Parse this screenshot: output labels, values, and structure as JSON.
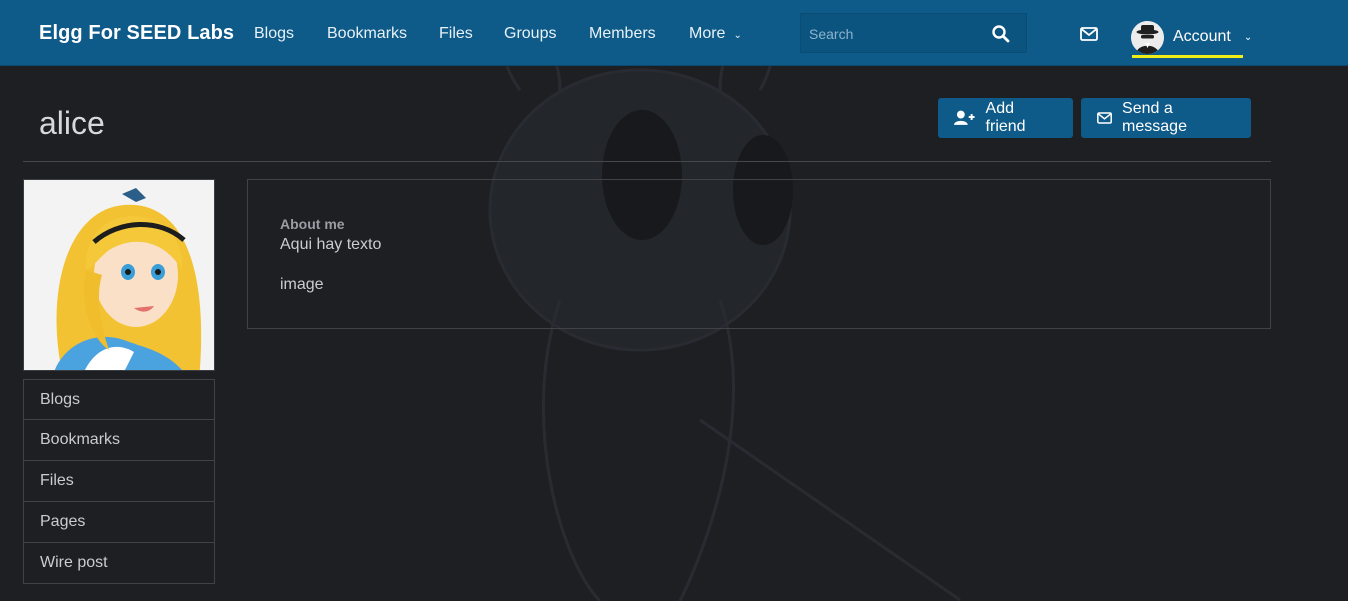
{
  "topbar": {
    "brand": "Elgg For SEED Labs",
    "nav": [
      "Blogs",
      "Bookmarks",
      "Files",
      "Groups",
      "Members",
      "More"
    ],
    "search_placeholder": "Search",
    "account_label": "Account",
    "accent_color": "#0e5a88"
  },
  "profile": {
    "name": "alice",
    "actions": {
      "add_friend": "Add friend",
      "send_message": "Send a message"
    },
    "menu": [
      "Blogs",
      "Bookmarks",
      "Files",
      "Pages",
      "Wire post"
    ],
    "about": {
      "label": "About me",
      "lines": [
        "Aqui hay texto",
        "image"
      ]
    }
  },
  "icons": {
    "search": "search-icon",
    "mail": "envelope-icon",
    "account_avatar": "spy-avatar-icon",
    "add_friend": "user-plus-icon",
    "send_message": "envelope-icon",
    "more_chevron": "chevron-down-icon"
  }
}
